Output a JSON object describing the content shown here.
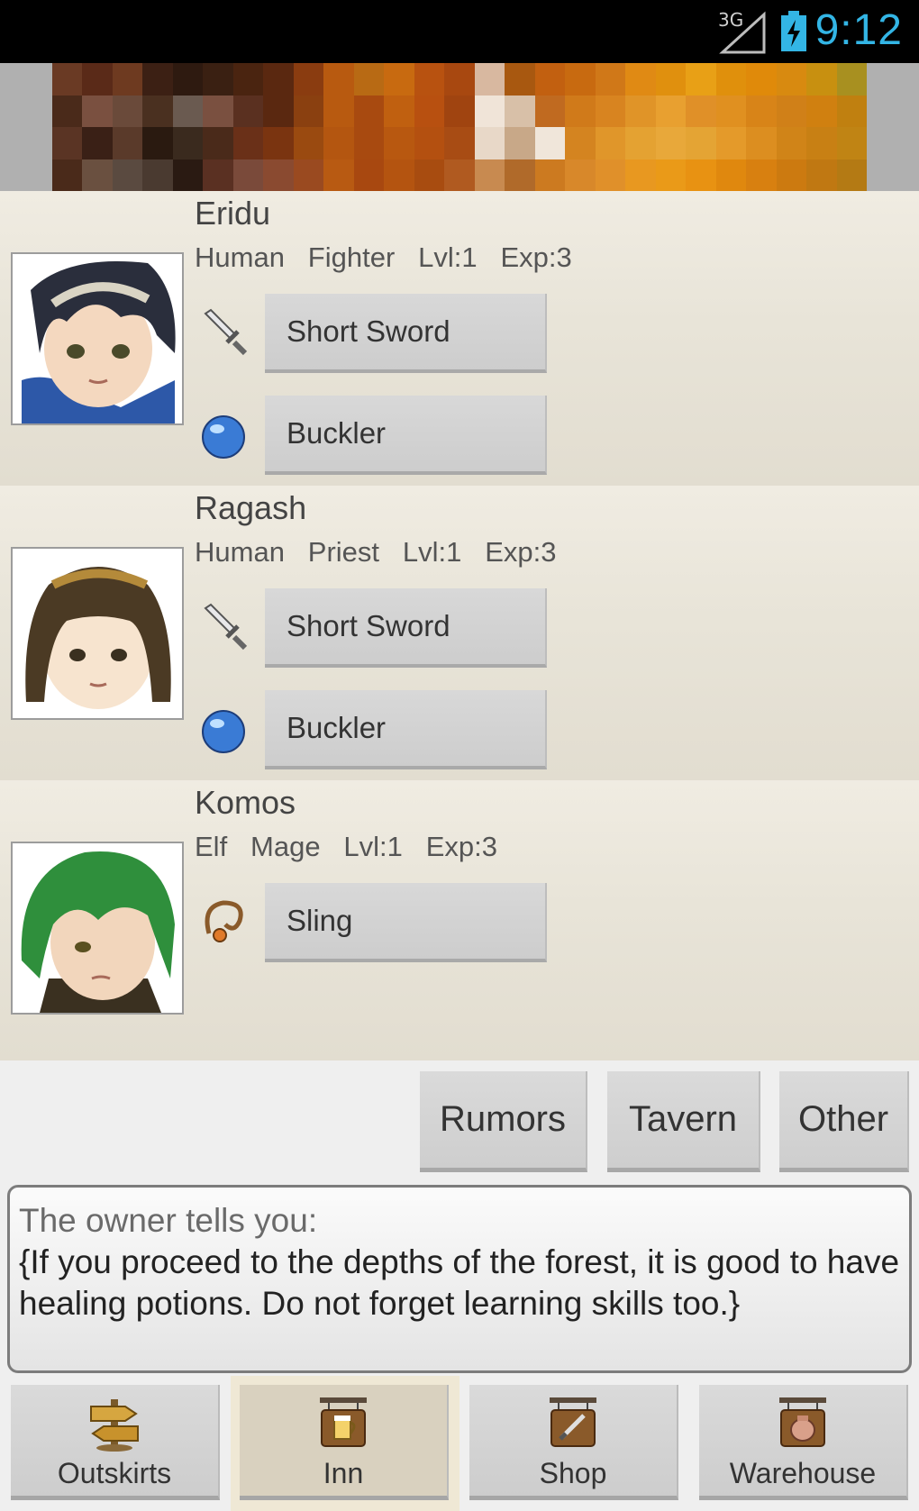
{
  "status_bar": {
    "network": "3G",
    "time": "9:12",
    "clock_color": "#33b5e5"
  },
  "banner": {
    "icon": "blurred-scene-image"
  },
  "party": [
    {
      "name": "Eridu",
      "race": "Human",
      "class": "Fighter",
      "level": "Lvl:1",
      "exp": "Exp:3",
      "equipment": [
        {
          "icon": "sword-icon",
          "label": "Short Sword"
        },
        {
          "icon": "shield-orb-icon",
          "label": "Buckler"
        }
      ]
    },
    {
      "name": "Ragash",
      "race": "Human",
      "class": "Priest",
      "level": "Lvl:1",
      "exp": "Exp:3",
      "equipment": [
        {
          "icon": "sword-icon",
          "label": "Short Sword"
        },
        {
          "icon": "shield-orb-icon",
          "label": "Buckler"
        }
      ]
    },
    {
      "name": "Komos",
      "race": "Elf",
      "class": "Mage",
      "level": "Lvl:1",
      "exp": "Exp:3",
      "equipment": [
        {
          "icon": "sling-icon",
          "label": "Sling"
        }
      ]
    }
  ],
  "actions": {
    "rumors": "Rumors",
    "tavern": "Tavern",
    "other": "Other"
  },
  "dialog": {
    "intro": "The owner tells you:",
    "text": "{If you proceed to the depths of the forest, it is good to have healing potions. Do not forget learning skills too.}"
  },
  "nav": [
    {
      "label": "Outskirts",
      "icon": "signpost-icon",
      "active": false
    },
    {
      "label": "Inn",
      "icon": "inn-sign-icon",
      "active": true
    },
    {
      "label": "Shop",
      "icon": "shop-sign-icon",
      "active": false
    },
    {
      "label": "Warehouse",
      "icon": "warehouse-sign-icon",
      "active": false
    }
  ]
}
